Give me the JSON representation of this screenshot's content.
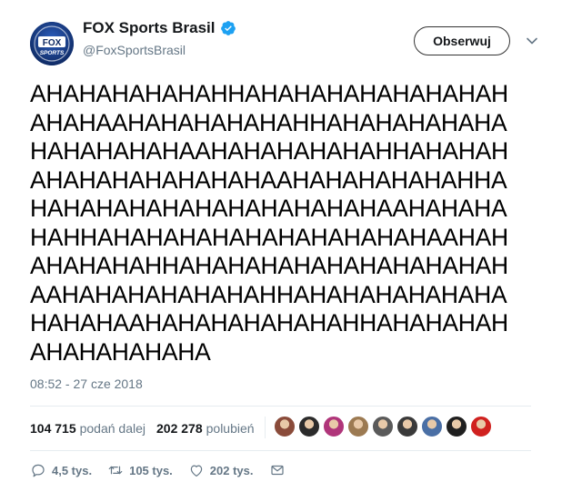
{
  "user": {
    "display_name": "FOX Sports Brasil",
    "handle": "@FoxSportsBrasil",
    "avatar_text": "FOX SPORTS",
    "follow_label": "Obserwuj"
  },
  "tweet": {
    "lines": [
      "AHAHAHAHAHAHHAHAHAHAHAHAHAHAH",
      "AHAHAAHAHAHAHAHAHHAHAHAHAHAHA",
      "HAHAHAHAHAAHAHAHAHAHAHHAHAHAH",
      "AHAHAHAHAHAHAHAAHAHAHAHAHAHHA",
      "HAHAHAHAHAHAHAHAHAHAHAAHAHAHA",
      "HAHHAHAHAHAHAHAHAHAHAHAHAAHAH",
      "AHAHAHAHHAHAHAHAHAHAHAHAHAHAH",
      "AAHAHAHAHAHAHAHHAHAHAHAHAHAHA",
      "HAHAHAAHAHAHAHAHAHAHHAHAHAHAH",
      "AHAHAHAHAHA"
    ],
    "timestamp": "08:52 - 27 cze 2018"
  },
  "stats": {
    "retweets_count": "104 715",
    "retweets_label": "podań dalej",
    "likes_count": "202 278",
    "likes_label": "polubień"
  },
  "likers": [
    {
      "name": "liker-avatar-1",
      "color": "#8a4b3a"
    },
    {
      "name": "liker-avatar-2",
      "color": "#2b2b2b"
    },
    {
      "name": "liker-avatar-3",
      "color": "#b0357a"
    },
    {
      "name": "liker-avatar-4",
      "color": "#9c7a52"
    },
    {
      "name": "liker-avatar-5",
      "color": "#5a5a5a"
    },
    {
      "name": "liker-avatar-6",
      "color": "#3a3a3a"
    },
    {
      "name": "liker-avatar-7",
      "color": "#4a6fa5"
    },
    {
      "name": "liker-avatar-8",
      "color": "#1f1f1f"
    },
    {
      "name": "liker-avatar-9",
      "color": "#d0211f"
    }
  ],
  "actions": {
    "replies": "4,5 tys.",
    "retweets": "105 tys.",
    "likes": "202 tys."
  },
  "colors": {
    "verified_blue": "#1da1f2",
    "secondary_text": "#657786",
    "avatar_bg": "#1a3e8c"
  }
}
